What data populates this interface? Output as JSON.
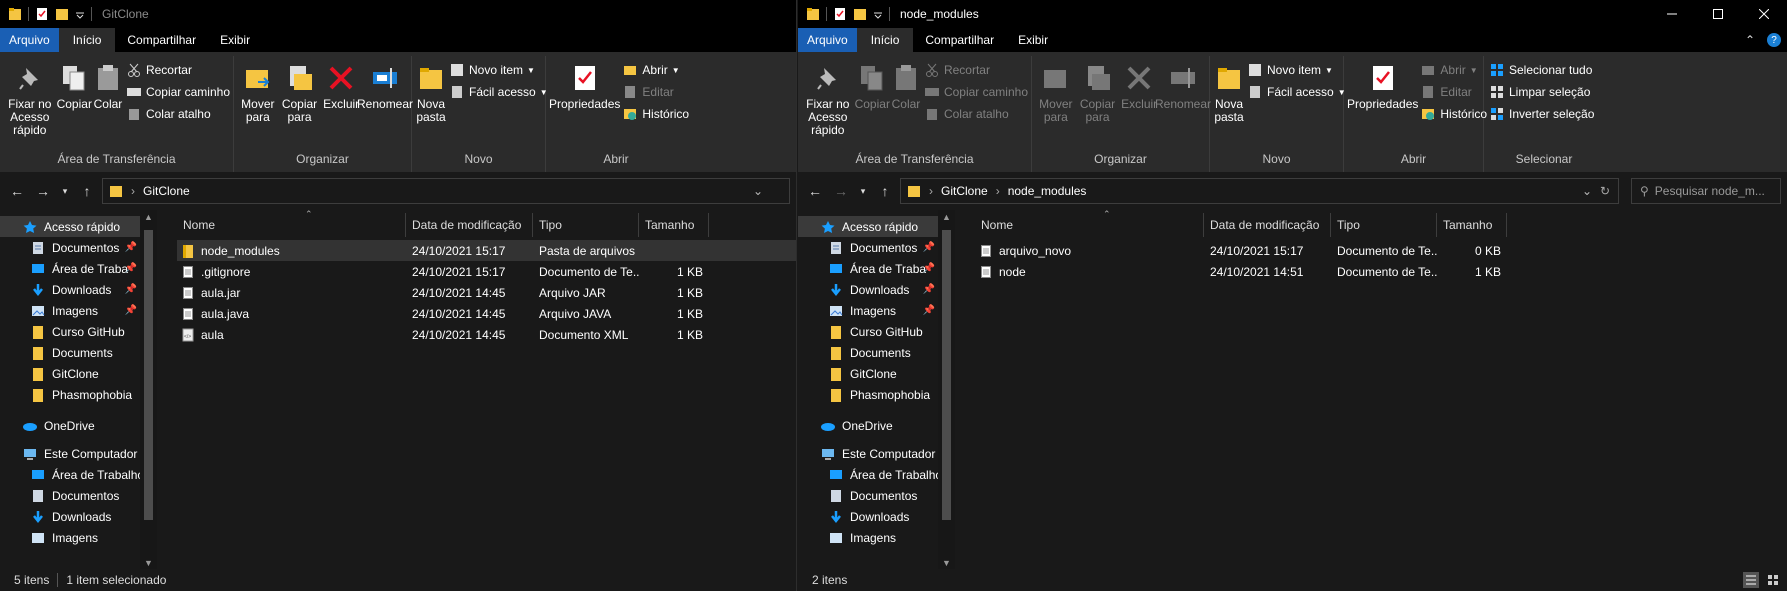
{
  "icons": [
    "folder-icon",
    "document-icon",
    "pin-icon",
    "cut-icon",
    "copy-icon",
    "paste-icon",
    "delete-icon",
    "rename-icon",
    "properties-icon",
    "history-icon",
    "download-icon",
    "image-icon",
    "onedrive-icon",
    "computer-icon",
    "desktop-icon",
    "search-icon",
    "refresh-icon"
  ],
  "colors": {
    "accent": "#1a5fb4",
    "folder": "#f5c542",
    "delete": "#e81123",
    "background": "#191919",
    "ribbon": "#2b2b2b"
  },
  "ribbon": {
    "tabs": {
      "file": "Arquivo",
      "home": "Início",
      "share": "Compartilhar",
      "view": "Exibir"
    },
    "clipboard": {
      "pin": "Fixar no Acesso rápido",
      "copy": "Copiar",
      "paste": "Colar",
      "cut": "Recortar",
      "copy_path": "Copiar caminho",
      "paste_shortcut": "Colar atalho",
      "label": "Área de Transferência"
    },
    "organize": {
      "move": "Mover para",
      "copy_to": "Copiar para",
      "delete": "Excluir",
      "rename": "Renomear",
      "label": "Organizar"
    },
    "new": {
      "new_folder": "Nova pasta",
      "new_item": "Novo item",
      "easy_access": "Fácil acesso",
      "label": "Novo"
    },
    "open": {
      "properties": "Propriedades",
      "open": "Abrir",
      "edit": "Editar",
      "history": "Histórico",
      "label": "Abrir"
    },
    "select": {
      "select_all": "Selecionar tudo",
      "select_none": "Limpar seleção",
      "invert": "Inverter seleção",
      "label": "Selecionar"
    }
  },
  "columns": {
    "name": "Nome",
    "date": "Data de modificação",
    "type": "Tipo",
    "size": "Tamanho"
  },
  "nav": {
    "quick_access": "Acesso rápido",
    "pinned": [
      "Documentos",
      "Área de Traba",
      "Downloads",
      "Imagens"
    ],
    "recent": [
      "Curso GitHub",
      "Documents",
      "GitClone",
      "Phasmophobia"
    ],
    "onedrive": "OneDrive",
    "this_pc": "Este Computador",
    "pc_items": [
      "Área de Trabalhc",
      "Documentos",
      "Downloads",
      "Imagens"
    ]
  },
  "window1": {
    "title": "GitClone",
    "breadcrumb": [
      "GitClone"
    ],
    "files": [
      {
        "name": "node_modules",
        "date": "24/10/2021 15:17",
        "type": "Pasta de arquivos",
        "size": "",
        "icon": "folder-icon"
      },
      {
        "name": ".gitignore",
        "date": "24/10/2021 15:17",
        "type": "Documento de Te...",
        "size": "1 KB",
        "icon": "document-icon"
      },
      {
        "name": "aula.jar",
        "date": "24/10/2021 14:45",
        "type": "Arquivo JAR",
        "size": "1 KB",
        "icon": "document-icon"
      },
      {
        "name": "aula.java",
        "date": "24/10/2021 14:45",
        "type": "Arquivo JAVA",
        "size": "1 KB",
        "icon": "document-icon"
      },
      {
        "name": "aula",
        "date": "24/10/2021 14:45",
        "type": "Documento XML",
        "size": "1 KB",
        "icon": "xml-icon"
      }
    ],
    "status": {
      "count": "5 itens",
      "selected": "1 item selecionado"
    }
  },
  "window2": {
    "title": "node_modules",
    "breadcrumb": [
      "GitClone",
      "node_modules"
    ],
    "search_placeholder": "Pesquisar node_m...",
    "files": [
      {
        "name": "arquivo_novo",
        "date": "24/10/2021 15:17",
        "type": "Documento de Te...",
        "size": "0 KB",
        "icon": "document-icon"
      },
      {
        "name": "node",
        "date": "24/10/2021 14:51",
        "type": "Documento de Te...",
        "size": "1 KB",
        "icon": "document-icon"
      }
    ],
    "status": {
      "count": "2 itens"
    }
  }
}
